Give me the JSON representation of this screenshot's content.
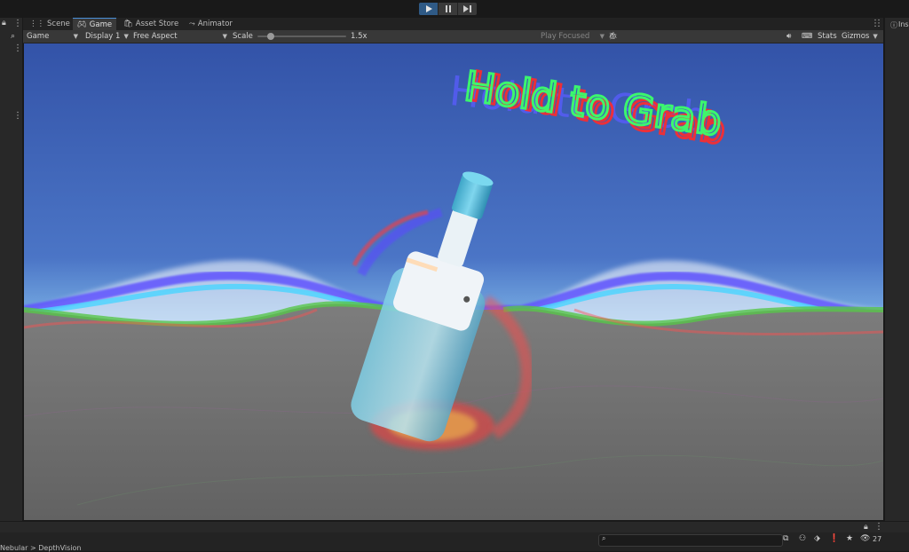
{
  "playbar": {
    "play_icon": "play-icon",
    "pause_icon": "pause-icon",
    "step_icon": "step-icon"
  },
  "tabs": [
    {
      "label": "Scene",
      "icon": "scene-icon"
    },
    {
      "label": "Game",
      "icon": "game-controller-icon"
    },
    {
      "label": "Asset Store",
      "icon": "store-bag-icon"
    },
    {
      "label": "Animator",
      "icon": "animator-icon"
    }
  ],
  "right_tab": {
    "label": "Ins"
  },
  "toolbar": {
    "view_mode": "Game",
    "display": "Display 1",
    "aspect": "Free Aspect",
    "scale_label": "Scale",
    "scale_value": "1.5x",
    "scale_fraction": 0.15,
    "play_focused": "Play Focused",
    "stats": "Stats",
    "gizmos": "Gizmos"
  },
  "scene": {
    "floating_text": "Hold to Grab"
  },
  "status": {
    "breadcrumb": "Nebular > DepthVision",
    "count": "27"
  },
  "colors": {
    "accent": "#2f5a86",
    "sky_top": "#3353a8",
    "ground": "#6c6c6c"
  }
}
